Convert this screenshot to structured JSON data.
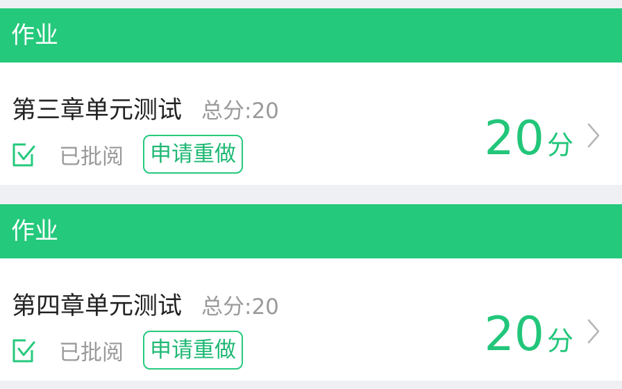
{
  "cards": [
    {
      "header": "作业",
      "title": "第三章单元测试",
      "total": "总分:20",
      "status": "已批阅",
      "redo_label": "申请重做",
      "score_value": "20",
      "score_unit": "分",
      "icons": {
        "status": "check-square-icon",
        "more": "chevron-right-icon"
      }
    },
    {
      "header": "作业",
      "title": "第四章单元测试",
      "total": "总分:20",
      "status": "已批阅",
      "redo_label": "申请重做",
      "score_value": "20",
      "score_unit": "分",
      "icons": {
        "status": "check-square-icon",
        "more": "chevron-right-icon"
      }
    }
  ],
  "colors": {
    "accent": "#25c97c",
    "score": "#22c67a",
    "page_background": "#eef0f3",
    "muted_text": "#9a9a9a"
  }
}
